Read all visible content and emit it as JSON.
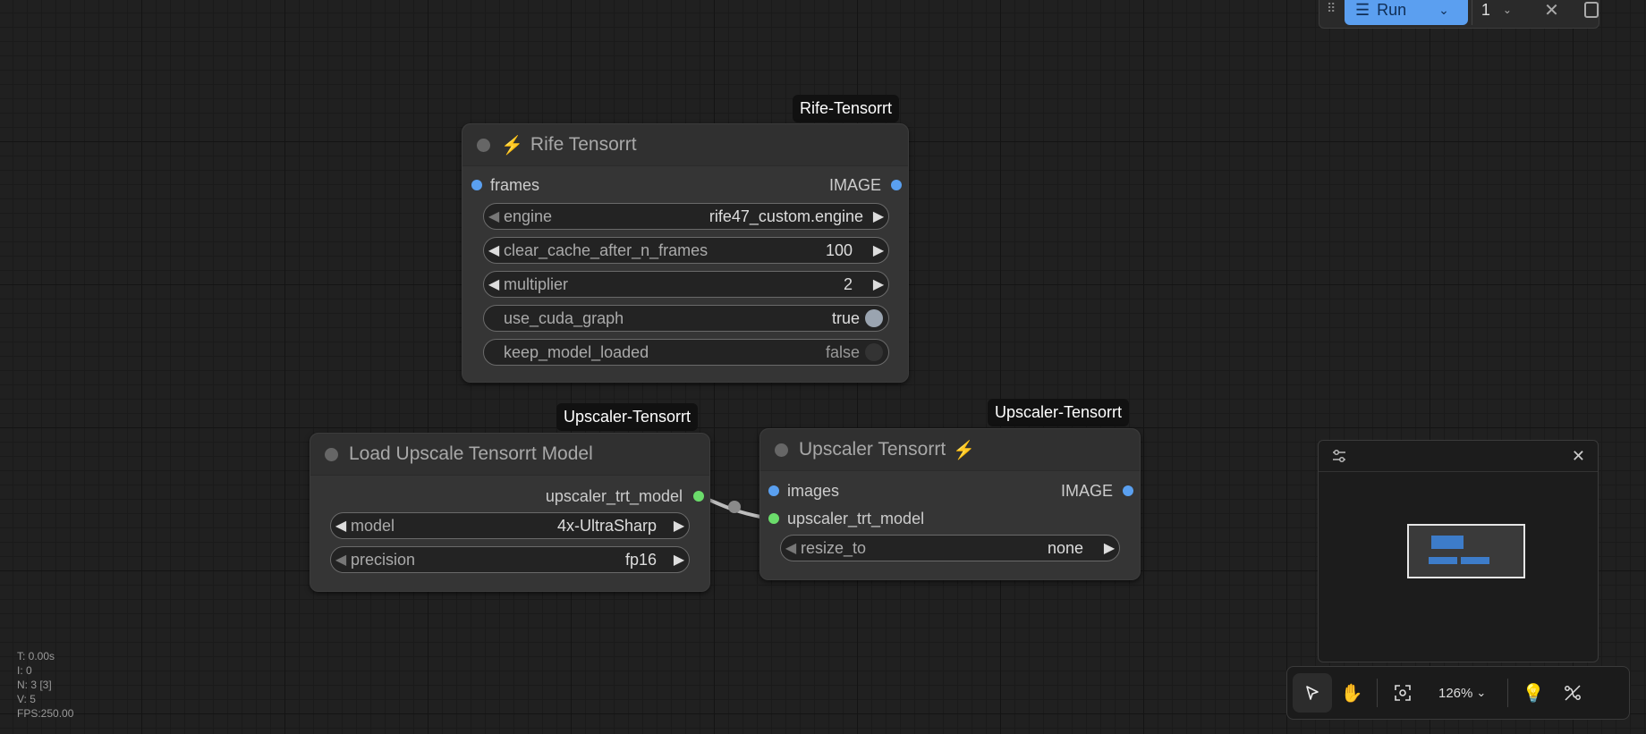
{
  "nodes": {
    "rife": {
      "badge": "Rife-Tensorrt",
      "title": "Rife Tensorrt",
      "input_label": "frames",
      "output_label": "IMAGE",
      "widgets": [
        {
          "label": "engine",
          "value": "rife47_custom.engine"
        },
        {
          "label": "clear_cache_after_n_frames",
          "value": "100"
        },
        {
          "label": "multiplier",
          "value": "2"
        },
        {
          "label": "use_cuda_graph",
          "value": "true"
        },
        {
          "label": "keep_model_loaded",
          "value": "false"
        }
      ]
    },
    "load_upscale": {
      "badge": "Upscaler-Tensorrt",
      "title": "Load Upscale Tensorrt Model",
      "output_label": "upscaler_trt_model",
      "widgets": [
        {
          "label": "model",
          "value": "4x-UltraSharp"
        },
        {
          "label": "precision",
          "value": "fp16"
        }
      ]
    },
    "upscaler": {
      "badge": "Upscaler-Tensorrt",
      "title": "Upscaler Tensorrt",
      "input1_label": "images",
      "input2_label": "upscaler_trt_model",
      "output_label": "IMAGE",
      "widgets": [
        {
          "label": "resize_to",
          "value": "none"
        }
      ]
    }
  },
  "topbar": {
    "run_label": "Run",
    "batch_count": "1"
  },
  "stats": {
    "t": "T: 0.00s",
    "i": "I: 0",
    "n": "N: 3 [3]",
    "v": "V: 5",
    "fps": "FPS:250.00"
  },
  "bottombar": {
    "zoom": "126%"
  },
  "colors": {
    "accent": "#5b9ff0",
    "port_image": "#5aa0f0",
    "port_model": "#6bdc6b",
    "bolt": "#f2c744"
  },
  "icons": [
    "bolt-icon",
    "pointer-icon",
    "hand-icon",
    "fit-view-icon",
    "chevron-down-icon",
    "lightbulb-icon",
    "hide-links-icon",
    "settings-icon",
    "close-icon"
  ]
}
